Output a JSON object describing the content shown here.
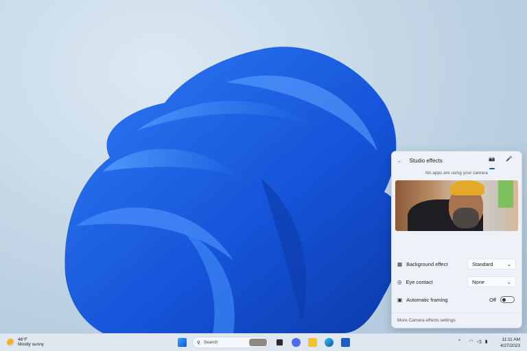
{
  "panel": {
    "title": "Studio effects",
    "status": "No apps are using your camera",
    "settings": [
      {
        "label": "Background effect",
        "value": "Standard",
        "icon": "background-blur-icon"
      },
      {
        "label": "Eye contact",
        "value": "None",
        "icon": "eye-contact-icon"
      },
      {
        "label": "Automatic framing",
        "value": "Off",
        "icon": "framing-icon"
      }
    ],
    "automatic_framing_on": false,
    "footer": "More Camera effects settings"
  },
  "taskbar": {
    "weather": {
      "temp": "46°F",
      "condition": "Mostly sunny"
    },
    "search_placeholder": "Search",
    "time": "11:11 AM",
    "date": "4/27/2023"
  },
  "colors": {
    "accent": "#0a5bc4",
    "bloom": "#1a5fe0"
  }
}
